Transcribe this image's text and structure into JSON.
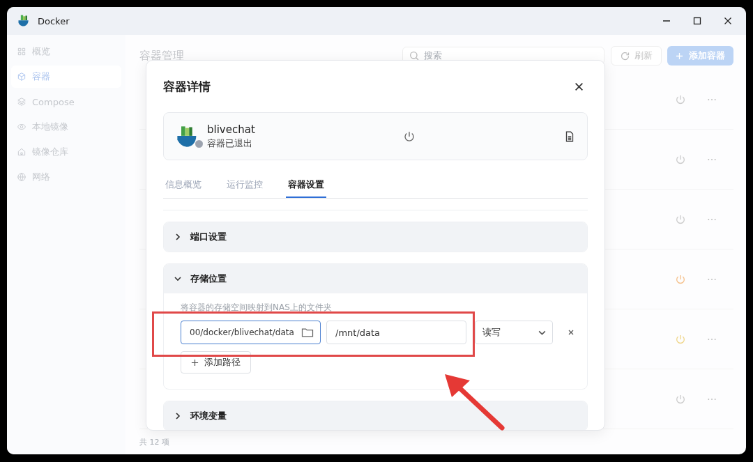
{
  "window": {
    "title": "Docker"
  },
  "sidebar": {
    "items": [
      {
        "label": "概览",
        "selected": false
      },
      {
        "label": "容器",
        "selected": true
      },
      {
        "label": "Compose",
        "selected": false
      },
      {
        "label": "本地镜像",
        "selected": false
      },
      {
        "label": "镜像仓库",
        "selected": false
      },
      {
        "label": "网络",
        "selected": false
      }
    ]
  },
  "page": {
    "title": "容器管理",
    "search": {
      "placeholder": "搜索"
    },
    "refresh_button": "刷新",
    "add_button": "添加容器",
    "rows": [
      {
        "color": "#cccccc"
      },
      {
        "color": "#cccccc"
      },
      {
        "color": "#cccccc"
      },
      {
        "color": "#f5c08a"
      },
      {
        "color": "#f0d68a"
      },
      {
        "color": "#cccccc"
      }
    ],
    "footer": "共 12 项"
  },
  "dialog": {
    "title": "容器详情",
    "container": {
      "name": "blivechat",
      "status": "容器已退出",
      "color": "#9ca3af"
    },
    "tabs": [
      {
        "label": "信息概览",
        "selected": false
      },
      {
        "label": "运行监控",
        "selected": false
      },
      {
        "label": "容器设置",
        "selected": true
      }
    ],
    "sections": [
      {
        "title": "端口设置",
        "expanded": false
      },
      {
        "title": "存储位置",
        "expanded": true,
        "description": "将容器的存储空间映射到NAS上的文件夹",
        "mappings": [
          {
            "host_path": "00/docker/blivechat/data",
            "container_path": "/mnt/data",
            "mode": "读写"
          }
        ],
        "add_button": "添加路径"
      },
      {
        "title": "环境变量",
        "expanded": false
      }
    ]
  }
}
